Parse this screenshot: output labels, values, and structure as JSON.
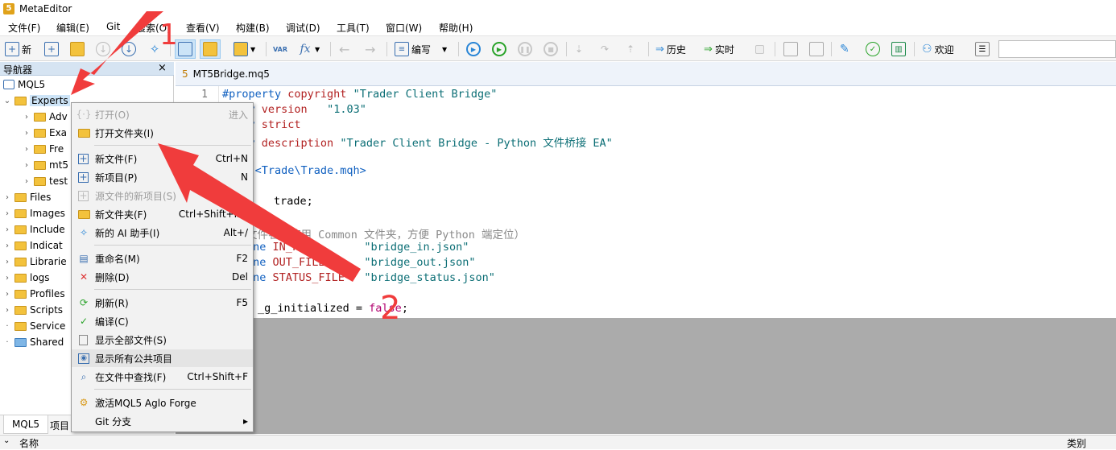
{
  "window": {
    "title": "MetaEditor"
  },
  "menubar": [
    "文件(F)",
    "编辑(E)",
    "Git",
    "搜索(O)",
    "查看(V)",
    "构建(B)",
    "调试(D)",
    "工具(T)",
    "窗口(W)",
    "帮助(H)"
  ],
  "toolbar": {
    "new_label": "新",
    "compile_label": "编写",
    "history_label": "历史",
    "realtime_label": "实时",
    "welcome_label": "欢迎",
    "var_label": "VAR",
    "fx_label": "fx"
  },
  "navigator": {
    "title": "导航器",
    "close": "×",
    "root": "MQL5",
    "experts": "Experts",
    "experts_children": [
      "Adv",
      "Exa",
      "Fre",
      "mt5",
      "test"
    ],
    "folders": [
      "Files",
      "Images",
      "Include",
      "Indicat",
      "Librarie",
      "logs",
      "Profiles",
      "Scripts",
      "Service",
      "Shared"
    ],
    "tabs": {
      "mql5": "MQL5",
      "project": "项目"
    }
  },
  "editor": {
    "tab_number": "5",
    "tab_file": "MT5Bridge.mq5",
    "line_number": "1",
    "lines": {
      "l1_a": "#property ",
      "l1_b": "copyright ",
      "l1_c": "\"Trader Client Bridge\"",
      "l2_a": "perty ",
      "l2_b": "version   ",
      "l2_c": "\"1.03\"",
      "l3_a": "perty ",
      "l3_b": "strict",
      "l4_a": "perty ",
      "l4_b": "description ",
      "l4_c": "\"Trader Client Bridge - Python 文件桥接 EA\"",
      "l5": "lude <Trade\\Trade.mqh>",
      "l6": "trade;",
      "l7": "文件名（使用 Common 文件夹，方便 Python 端定位）",
      "l8_a": "ine ",
      "l8_b": "IN_FILE       ",
      "l8_c": "\"bridge_in.json\"",
      "l9_a": "ine ",
      "l9_b": "OUT_FILE      ",
      "l9_c": "\"bridge_out.json\"",
      "l10_a": "ine ",
      "l10_b": "STATUS_FILE   ",
      "l10_c": "\"bridge_status.json\"",
      "l11_a": "_g_initialized = ",
      "l11_b": "false",
      "l11_c": ";"
    }
  },
  "context_menu": {
    "items": [
      {
        "label": "打开(O)",
        "shortcut": "进入",
        "disabled": true
      },
      {
        "label": "打开文件夹(I)",
        "shortcut": ""
      },
      {
        "label": "新文件(F)",
        "shortcut": "Ctrl+N"
      },
      {
        "label": "新项目(P)",
        "shortcut": "N"
      },
      {
        "label": "源文件的新项目(S)",
        "shortcut": "",
        "disabled": true
      },
      {
        "label": "新文件夹(F)",
        "shortcut": "Ctrl+Shift+Ins"
      },
      {
        "label": "新的 AI 助手(I)",
        "shortcut": "Alt+/"
      },
      {
        "label": "重命名(M)",
        "shortcut": "F2"
      },
      {
        "label": "删除(D)",
        "shortcut": "Del"
      },
      {
        "label": "刷新(R)",
        "shortcut": "F5"
      },
      {
        "label": "编译(C)",
        "shortcut": ""
      },
      {
        "label": "显示全部文件(S)",
        "shortcut": ""
      },
      {
        "label": "显示所有公共项目",
        "shortcut": ""
      },
      {
        "label": "在文件中查找(F)",
        "shortcut": "Ctrl+Shift+F"
      },
      {
        "label": "激活MQL5 Aglo Forge",
        "shortcut": ""
      },
      {
        "label": "Git 分支",
        "shortcut": "▸"
      }
    ]
  },
  "bottom": {
    "left_label": "名称",
    "right_label": "类别"
  },
  "annotations": {
    "marker_1": "1",
    "marker_2": "2",
    "arrow_color": "#f03c3c"
  }
}
